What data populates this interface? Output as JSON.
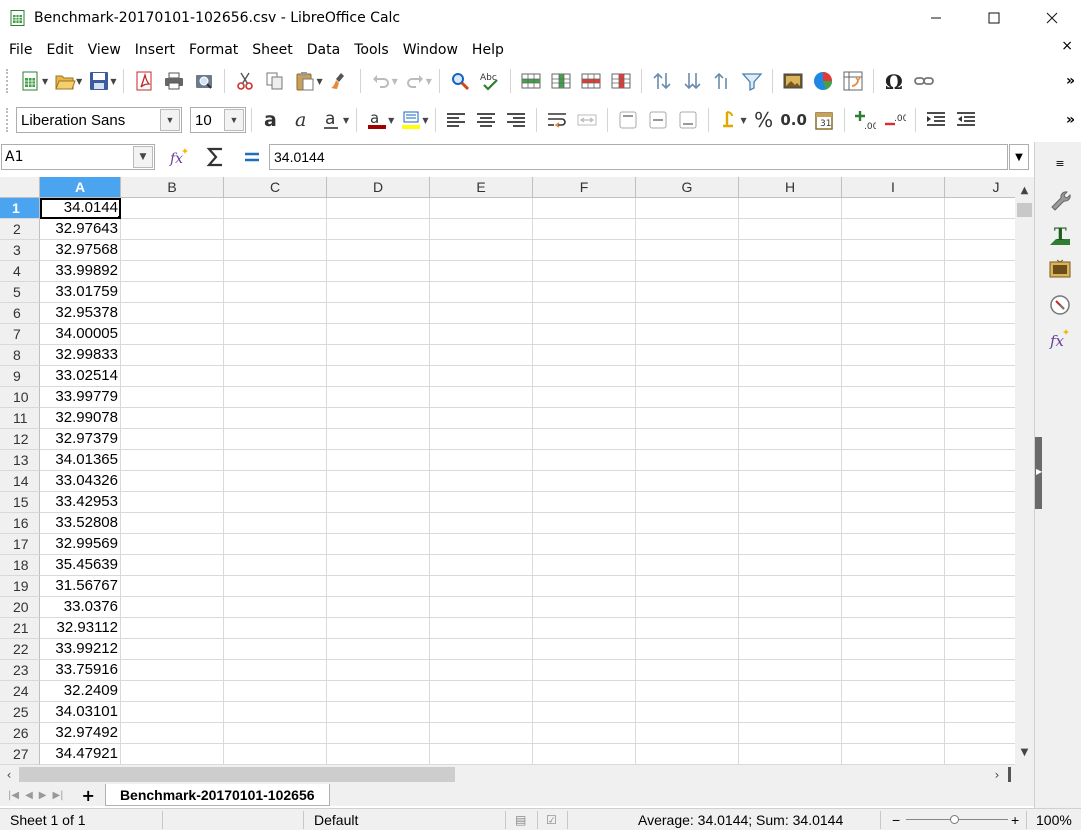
{
  "window": {
    "title": "Benchmark-20170101-102656.csv - LibreOffice Calc",
    "app_icon": "calc-icon",
    "controls": [
      "minimize-icon",
      "maximize-icon",
      "close-icon"
    ]
  },
  "menu": {
    "items": [
      {
        "label": "File",
        "key": "F"
      },
      {
        "label": "Edit",
        "key": "E"
      },
      {
        "label": "View",
        "key": "V"
      },
      {
        "label": "Insert",
        "key": "I"
      },
      {
        "label": "Format",
        "key": "o"
      },
      {
        "label": "Sheet",
        "key": "S"
      },
      {
        "label": "Data",
        "key": "D"
      },
      {
        "label": "Tools",
        "key": "T"
      },
      {
        "label": "Window",
        "key": "W"
      },
      {
        "label": "Help",
        "key": "H"
      }
    ],
    "close_glyph": "×"
  },
  "toolbar": {
    "more_glyph": "»"
  },
  "format": {
    "font_name": "Liberation Sans",
    "font_size": "10",
    "percent_label": "%",
    "number_label": "0.0"
  },
  "formula": {
    "cell_ref": "A1",
    "value": "34.0144"
  },
  "grid": {
    "columns": [
      "A",
      "B",
      "C",
      "D",
      "E",
      "F",
      "G",
      "H",
      "I",
      "J"
    ],
    "rows": [
      {
        "num": "1",
        "a": "34.0144"
      },
      {
        "num": "2",
        "a": "32.97643"
      },
      {
        "num": "3",
        "a": "32.97568"
      },
      {
        "num": "4",
        "a": "33.99892"
      },
      {
        "num": "5",
        "a": "33.01759"
      },
      {
        "num": "6",
        "a": "32.95378"
      },
      {
        "num": "7",
        "a": "34.00005"
      },
      {
        "num": "8",
        "a": "32.99833"
      },
      {
        "num": "9",
        "a": "33.02514"
      },
      {
        "num": "10",
        "a": "33.99779"
      },
      {
        "num": "11",
        "a": "32.99078"
      },
      {
        "num": "12",
        "a": "32.97379"
      },
      {
        "num": "13",
        "a": "34.01365"
      },
      {
        "num": "14",
        "a": "33.04326"
      },
      {
        "num": "15",
        "a": "33.42953"
      },
      {
        "num": "16",
        "a": "33.52808"
      },
      {
        "num": "17",
        "a": "32.99569"
      },
      {
        "num": "18",
        "a": "35.45639"
      },
      {
        "num": "19",
        "a": "31.56767"
      },
      {
        "num": "20",
        "a": "33.0376"
      },
      {
        "num": "21",
        "a": "32.93112"
      },
      {
        "num": "22",
        "a": "33.99212"
      },
      {
        "num": "23",
        "a": "33.75916"
      },
      {
        "num": "24",
        "a": "32.2409"
      },
      {
        "num": "25",
        "a": "34.03101"
      },
      {
        "num": "26",
        "a": "32.97492"
      },
      {
        "num": "27",
        "a": "34.47921"
      }
    ]
  },
  "sheets": {
    "active_tab": "Benchmark-20170101-102656",
    "add_glyph": "+"
  },
  "status": {
    "sheet_info": "Sheet 1 of 1",
    "page_style": "Default",
    "summary": "Average: 34.0144; Sum: 34.0144",
    "zoom": "100%",
    "zoom_minus": "−",
    "zoom_plus": "+"
  }
}
